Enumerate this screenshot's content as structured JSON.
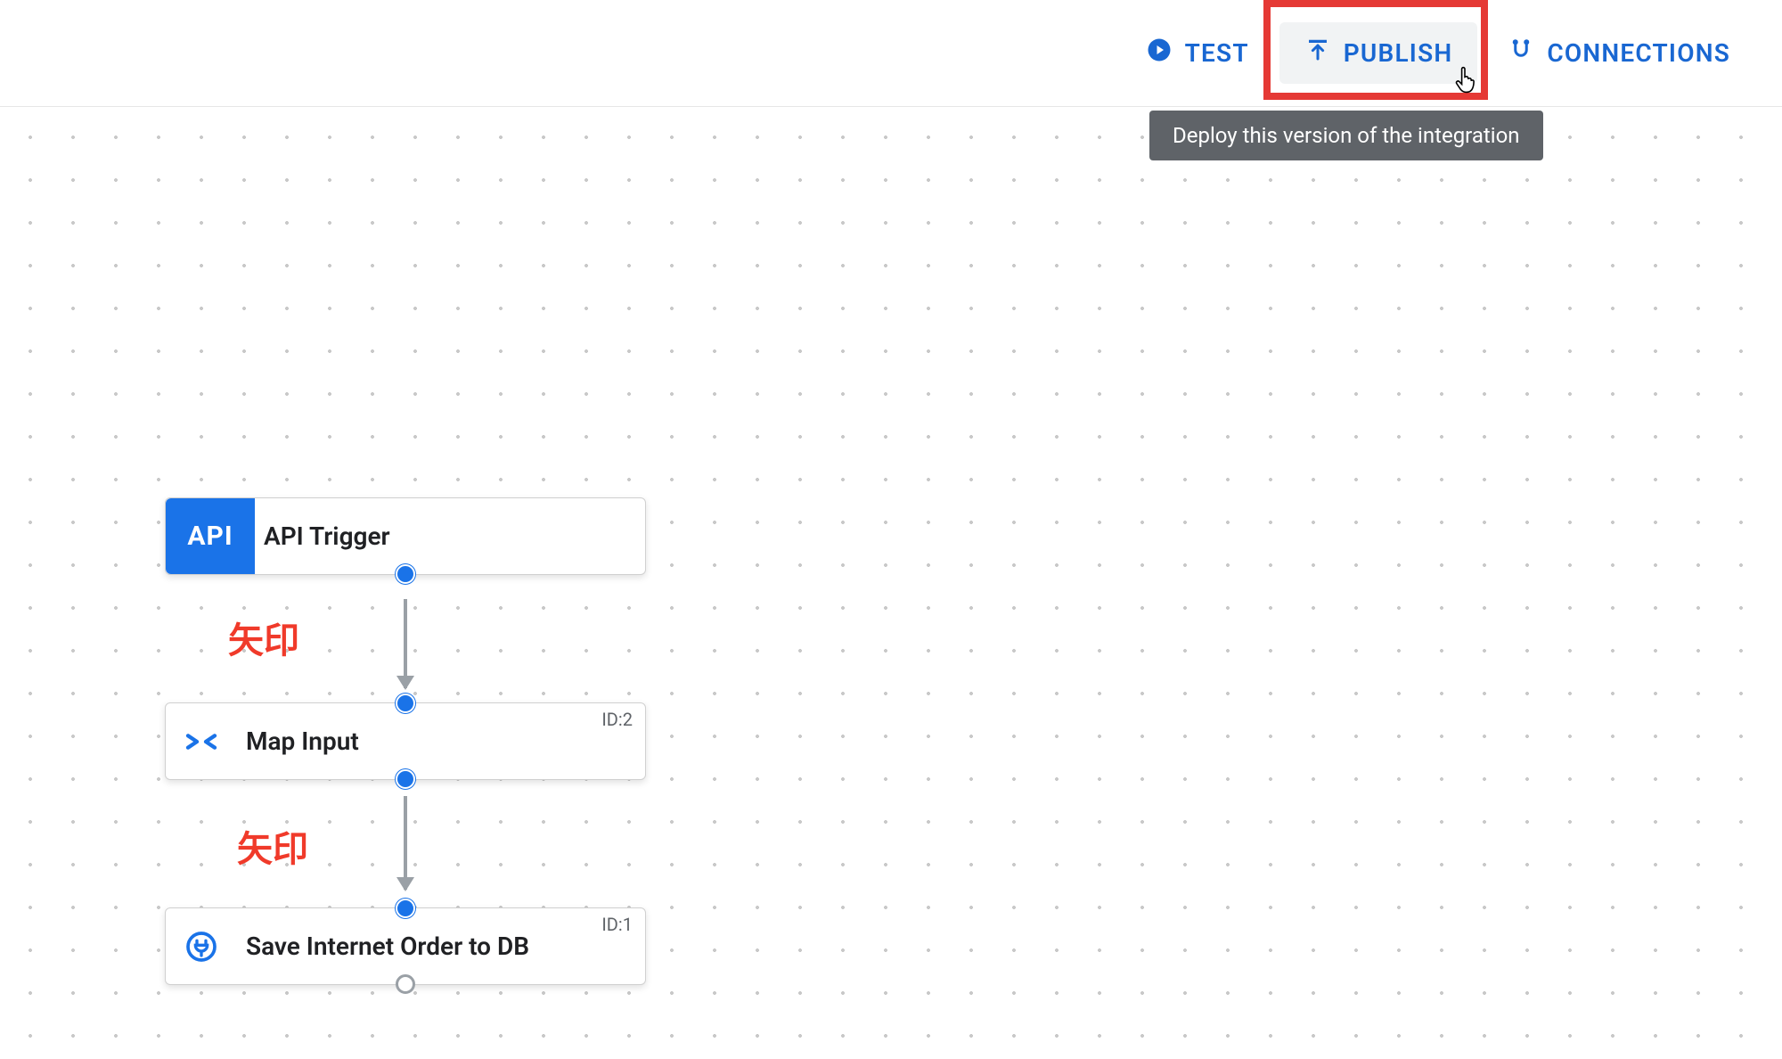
{
  "toolbar": {
    "test_label": "TEST",
    "publish_label": "PUBLISH",
    "connections_label": "CONNECTIONS",
    "publish_tooltip": "Deploy this version of the integration"
  },
  "nodes": {
    "trigger": {
      "badge": "API",
      "title": "API Trigger"
    },
    "map": {
      "title": "Map Input",
      "id_label": "ID:2"
    },
    "save": {
      "title": "Save Internet Order to DB",
      "id_label": "ID:1"
    }
  },
  "annotations": {
    "arrow1": "矢印",
    "arrow2": "矢印"
  },
  "colors": {
    "accent": "#1a73e8",
    "link": "#1967d2",
    "highlight": "#e53935",
    "annot": "#f03a2a"
  }
}
